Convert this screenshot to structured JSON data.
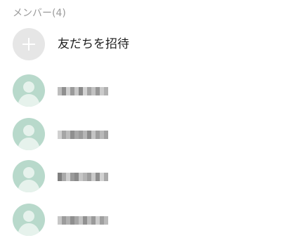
{
  "members_section": {
    "header": "メンバー(4)",
    "invite_label": "友だちを招待",
    "members": [
      {
        "icon": "default-avatar-icon",
        "name_display": "pixelated"
      },
      {
        "icon": "default-avatar-icon",
        "name_display": "pixelated"
      },
      {
        "icon": "default-avatar-icon",
        "name_display": "pixelated"
      },
      {
        "icon": "default-avatar-icon",
        "name_display": "pixelated"
      }
    ]
  },
  "colors": {
    "avatar_bg": "#b8d9cb",
    "avatar_figure": "#e6f2ec",
    "invite_bg": "#e6e6e6",
    "header_text": "#9b9b9b",
    "label_text": "#1e1e1e"
  }
}
